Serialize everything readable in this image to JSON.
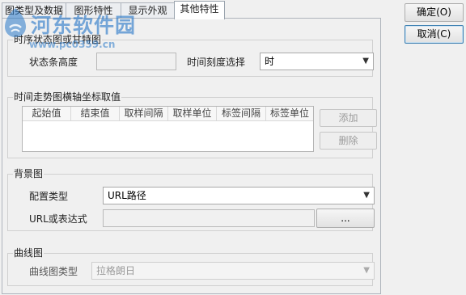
{
  "tabs": [
    {
      "label": "图类型及数据"
    },
    {
      "label": "图形特性"
    },
    {
      "label": "显示外观"
    },
    {
      "label": "其他特性"
    }
  ],
  "buttons": {
    "ok": "确定(O)",
    "cancel": "取消(C)"
  },
  "status_group": {
    "legend": "时序状态图或甘特图",
    "height_label": "状态条高度",
    "height_value": "",
    "time_scale_label": "时间刻度选择",
    "time_scale_value": "时"
  },
  "axis_group": {
    "legend": "时间走势图横轴坐标取值",
    "columns": [
      "起始值",
      "结束值",
      "取样间隔",
      "取样单位",
      "标签间隔",
      "标签单位"
    ],
    "add": "添加",
    "delete": "删除"
  },
  "background_group": {
    "legend": "背景图",
    "config_label": "配置类型",
    "config_value": "URL路径",
    "url_label": "URL或表达式",
    "url_value": "",
    "browse": "..."
  },
  "curve_group": {
    "legend": "曲线图",
    "type_label": "曲线图类型",
    "type_value": "拉格朗日"
  },
  "watermark": {
    "title": "河东软件园",
    "url": "www.pc0359.cn"
  }
}
